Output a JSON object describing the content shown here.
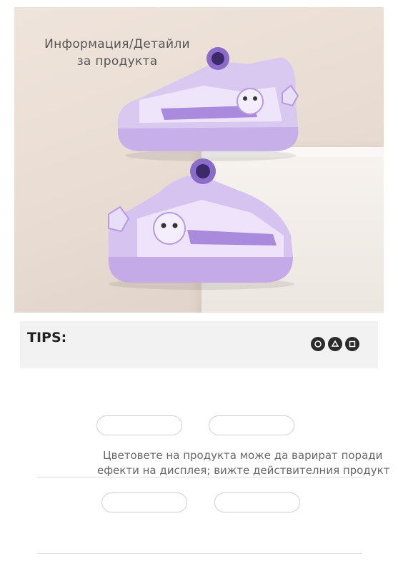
{
  "hero": {
    "title_line1": "Информация/Детайли",
    "title_line2": "за продукта",
    "accent_color": "#b59be0"
  },
  "tips": {
    "label": "TIPS:",
    "icons": [
      "badge-icon",
      "badge-icon",
      "badge-icon"
    ]
  },
  "notice": {
    "line1": "Цветовете на продукта може да варират поради",
    "line2": "ефекти на дисплея; вижте действителния продукт"
  }
}
